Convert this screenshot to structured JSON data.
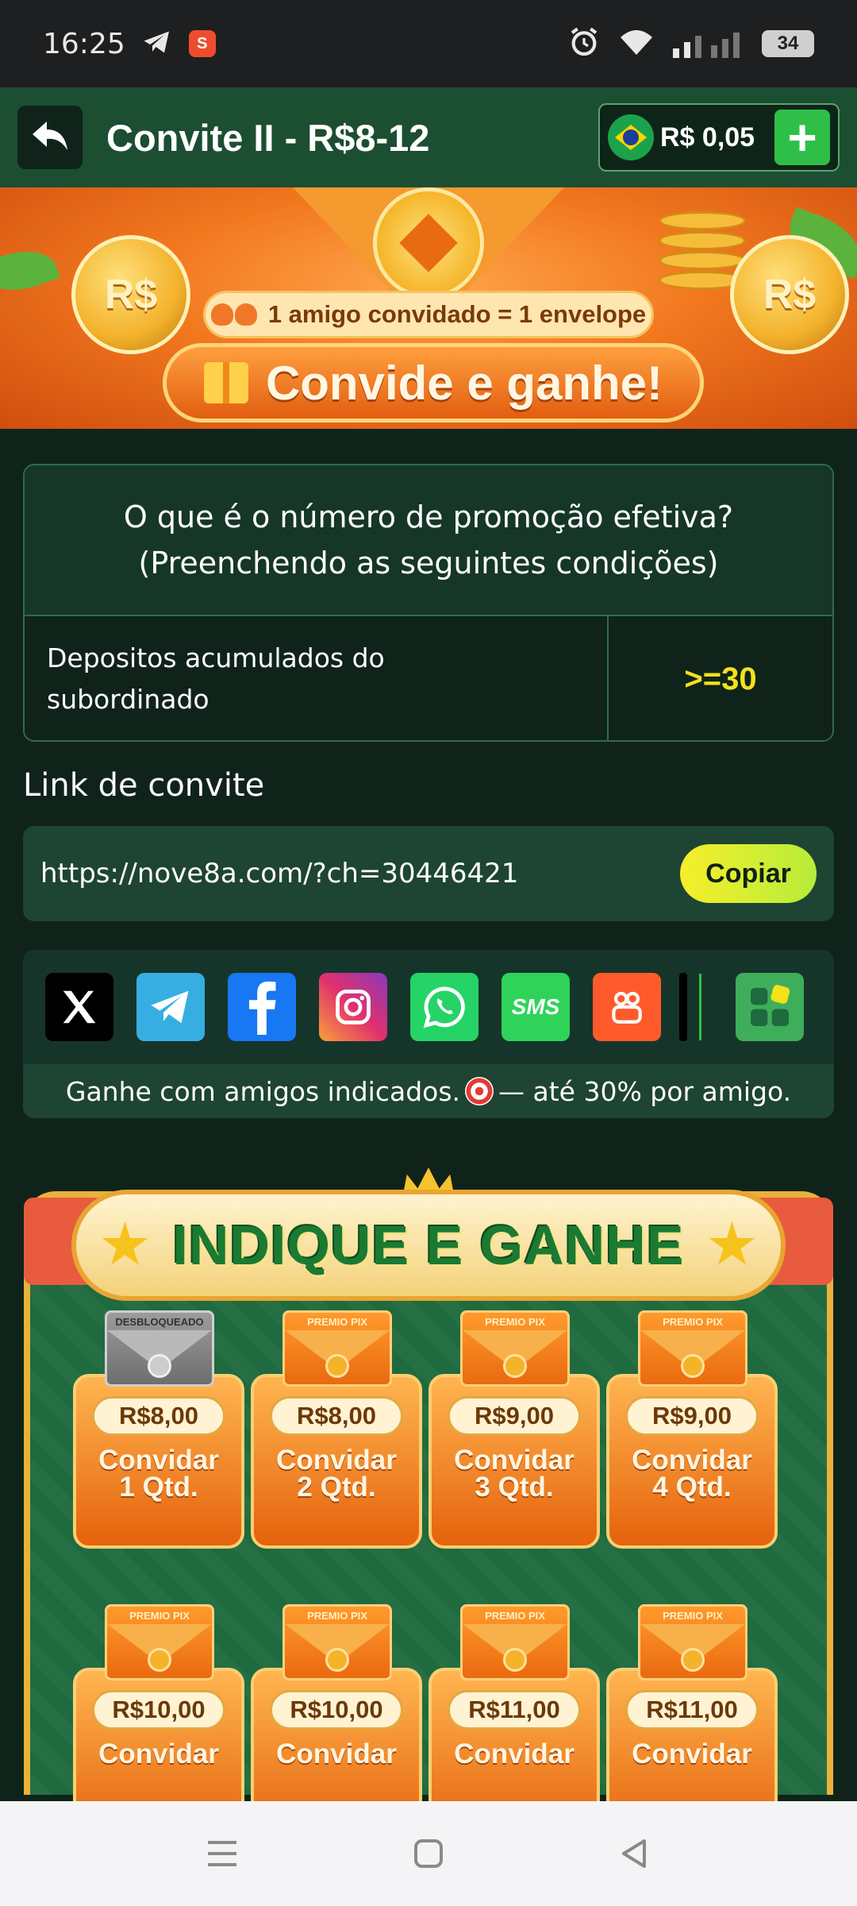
{
  "status_bar": {
    "time": "16:25",
    "shopee_badge": "S",
    "battery": "34",
    "icons": [
      "telegram-icon",
      "shopee-icon",
      "alarm-icon",
      "wifi-icon",
      "signal-icon",
      "battery-icon"
    ]
  },
  "header": {
    "title": "Convite II - R$8-12",
    "balance": "R$ 0,05",
    "add_label": "+",
    "colors": {
      "bar": "#1c4e32",
      "plus": "#2fbf48"
    }
  },
  "banner": {
    "subline": "1 amigo convidado = 1 envelope",
    "cta": "Convide e ganhe!",
    "coin_left": "R$",
    "coin_right": "R$"
  },
  "promo": {
    "question_line1": "O que é o número de promoção efetiva?",
    "question_line2": "(Preenchendo as seguintes condições)",
    "condition_label_line1": "Depositos acumulados do",
    "condition_label_line2": "subordinado",
    "condition_value": ">=30"
  },
  "invite": {
    "label": "Link de convite",
    "url": "https://nove8a.com/?ch=30446421",
    "copy_label": "Copiar"
  },
  "share": {
    "targets": [
      "x-icon",
      "telegram-icon",
      "facebook-icon",
      "instagram-icon",
      "whatsapp-icon",
      "sms-icon",
      "kwai-icon",
      "more-apps-icon"
    ],
    "sms_label": "SMS",
    "note_before": "Ganhe com amigos indicados.",
    "note_after": "— até 30% por amigo."
  },
  "rewards": {
    "title": "INDIQUE E GANHE",
    "envelope_label": "PREMIO PIX",
    "unlocked_label": "DESBLOQUEADO",
    "cards": [
      {
        "price": "R$8,00",
        "line1": "Convidar",
        "line2": "1 Qtd.",
        "unlocked": true
      },
      {
        "price": "R$8,00",
        "line1": "Convidar",
        "line2": "2 Qtd.",
        "unlocked": false
      },
      {
        "price": "R$9,00",
        "line1": "Convidar",
        "line2": "3 Qtd.",
        "unlocked": false
      },
      {
        "price": "R$9,00",
        "line1": "Convidar",
        "line2": "4 Qtd.",
        "unlocked": false
      },
      {
        "price": "R$10,00",
        "line1": "Convidar",
        "line2": "",
        "unlocked": false
      },
      {
        "price": "R$10,00",
        "line1": "Convidar",
        "line2": "",
        "unlocked": false
      },
      {
        "price": "R$11,00",
        "line1": "Convidar",
        "line2": "",
        "unlocked": false
      },
      {
        "price": "R$11,00",
        "line1": "Convidar",
        "line2": "",
        "unlocked": false
      }
    ]
  },
  "nav": [
    "menu-icon",
    "home-icon",
    "back-icon"
  ]
}
